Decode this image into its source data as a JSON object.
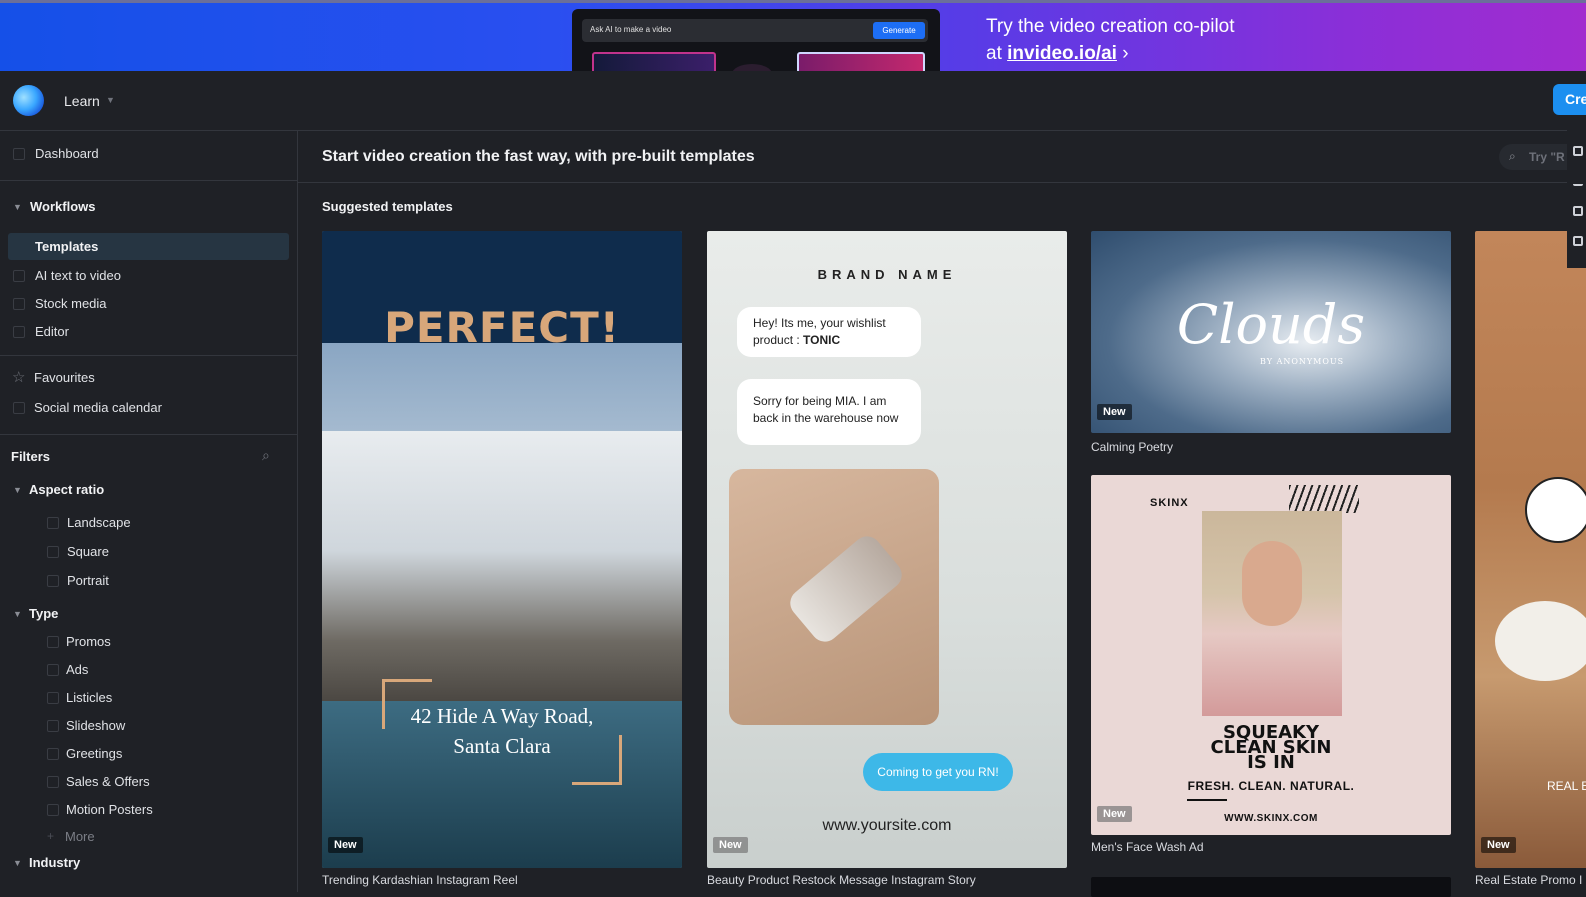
{
  "banner": {
    "ask_placeholder": "Ask AI to make a video",
    "generate_label": "Generate",
    "line1": "Try the video creation co-pilot",
    "line2_prefix": "at ",
    "line2_link": "invideo.io/ai",
    "line2_suffix": " ›"
  },
  "header": {
    "learn_label": "Learn",
    "create_label": "Cre"
  },
  "sidebar": {
    "dashboard": "Dashboard",
    "workflows": "Workflows",
    "workflow_items": [
      "Templates",
      "AI text to video",
      "Stock media",
      "Editor"
    ],
    "favourites": "Favourites",
    "social_calendar": "Social media calendar",
    "filters": "Filters",
    "aspect_ratio": "Aspect ratio",
    "aspect_items": [
      "Landscape",
      "Square",
      "Portrait"
    ],
    "type": "Type",
    "type_items": [
      "Promos",
      "Ads",
      "Listicles",
      "Slideshow",
      "Greetings",
      "Sales & Offers",
      "Motion Posters"
    ],
    "more": "More",
    "industry": "Industry"
  },
  "main": {
    "title": "Start video creation the fast way, with pre-built templates",
    "search_placeholder": "Try \"R",
    "section_title": "Suggested templates",
    "new_badge": "New",
    "cards": [
      {
        "caption": "Trending Kardashian Instagram Reel",
        "headline": "PERFECT!",
        "address_line1": "42 Hide A Way Road,",
        "address_line2": "Santa Clara"
      },
      {
        "caption": "Beauty Product Restock Message Instagram Story",
        "brand": "BRAND NAME",
        "bubble1_prefix": "Hey! Its me, your wishlist product : ",
        "bubble1_bold": "TONIC",
        "bubble2": "Sorry for being MIA. I am back in the warehouse now",
        "cta": "Coming to get you RN!",
        "site": "www.yoursite.com"
      },
      {
        "caption": "Calming Poetry",
        "title": "Clouds",
        "subtitle": "BY ANONYMOUS"
      },
      {
        "caption": "Men's Face Wash Ad",
        "brand": "SKINX",
        "headline_l1": "SQUEAKY",
        "headline_l2": "CLEAN SKIN",
        "headline_l3": "IS IN",
        "tagline": "FRESH. CLEAN. NATURAL.",
        "site": "WWW.SKINX.COM"
      },
      {
        "caption": "Real Estate Promo I",
        "overlay_text": "REAL E"
      }
    ]
  }
}
